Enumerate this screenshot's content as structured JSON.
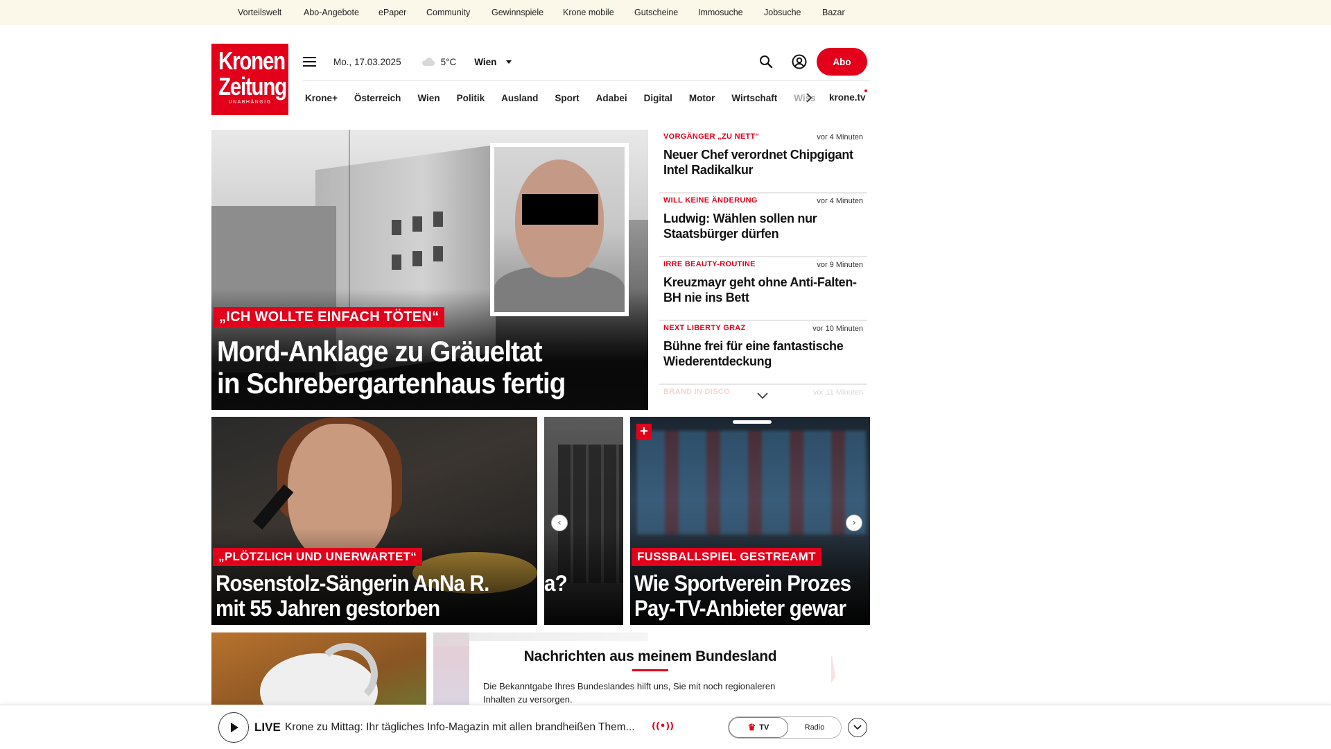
{
  "topnav": {
    "items": [
      "Vorteilswelt",
      "Abo-Angebote",
      "ePaper",
      "Community",
      "Gewinnspiele",
      "Krone mobile",
      "Gutscheine",
      "Immosuche",
      "Jobsuche",
      "Bazar"
    ]
  },
  "logo": {
    "line1": "Kronen",
    "line2": "Zeitung",
    "tagline": "UNABHÄNGIG"
  },
  "header": {
    "date": "Mo., 17.03.2025",
    "temperature": "5°C",
    "city": "Wien",
    "abo_label": "Abo"
  },
  "nav": {
    "items": [
      "Krone+",
      "Österreich",
      "Wien",
      "Politik",
      "Ausland",
      "Sport",
      "Adabei",
      "Digital",
      "Motor",
      "Wirtschaft",
      "Wiss"
    ],
    "tv_label": "krone.tv"
  },
  "hero": {
    "kicker": "„ICH WOLLTE EINFACH TÖTEN“",
    "title_line1": "Mord-Anklage zu Gräueltat",
    "title_line2": "in Schrebergartenhaus fertig"
  },
  "ticker": [
    {
      "kicker": "VORGÄNGER „ZU NETT“",
      "time": "vor 4 Minuten",
      "headline": "Neuer Chef verordnet Chipgigant Intel Radikalkur"
    },
    {
      "kicker": "WILL KEINE ÄNDERUNG",
      "time": "vor 4 Minuten",
      "headline": "Ludwig: Wählen sollen nur Staatsbürger dürfen"
    },
    {
      "kicker": "IRRE BEAUTY-ROUTINE",
      "time": "vor 9 Minuten",
      "headline": "Kreuzmayr geht ohne Anti-Falten-BH nie ins Bett"
    },
    {
      "kicker": "NEXT LIBERTY GRAZ",
      "time": "vor 10 Minuten",
      "headline": "Bühne frei für eine fantastische Wiederentdeckung"
    },
    {
      "kicker": "BRAND IN DISCO",
      "time": "vor 11 Minuten",
      "headline": ""
    }
  ],
  "cards": [
    {
      "kicker": "„PLÖTZLICH UND UNERWARTET“",
      "line1": "Rosenstolz-Sängerin AnNa R.",
      "line2": "mit 55 Jahren gestorben"
    },
    {
      "kicker": "",
      "line1": "",
      "line2": "a?"
    },
    {
      "kicker": "FUSSBALLSPIEL GESTREAMT",
      "line1": "Wie Sportverein Prozes",
      "line2": "Pay-TV-Anbieter gewar"
    }
  ],
  "bundesland": {
    "title": "Nachrichten aus meinem Bundesland",
    "text": "Die Bekanntgabe Ihres Bundeslandes hilft uns, Sie mit noch regionaleren Inhalten zu versorgen."
  },
  "player": {
    "live_label": "LIVE",
    "title": "Krone zu Mittag: Ihr tägliches Info-Magazin mit allen brandheißen Them...",
    "tv_label": "TV",
    "radio_label": "Radio"
  },
  "colors": {
    "brand_red": "#e2001a",
    "topbar_bg": "#fbf7e9"
  },
  "icons": [
    "menu-icon",
    "cloud-icon",
    "search-icon",
    "account-icon",
    "chevron-right-icon",
    "chevron-down-icon",
    "play-icon",
    "broadcast-icon",
    "crown-icon"
  ]
}
